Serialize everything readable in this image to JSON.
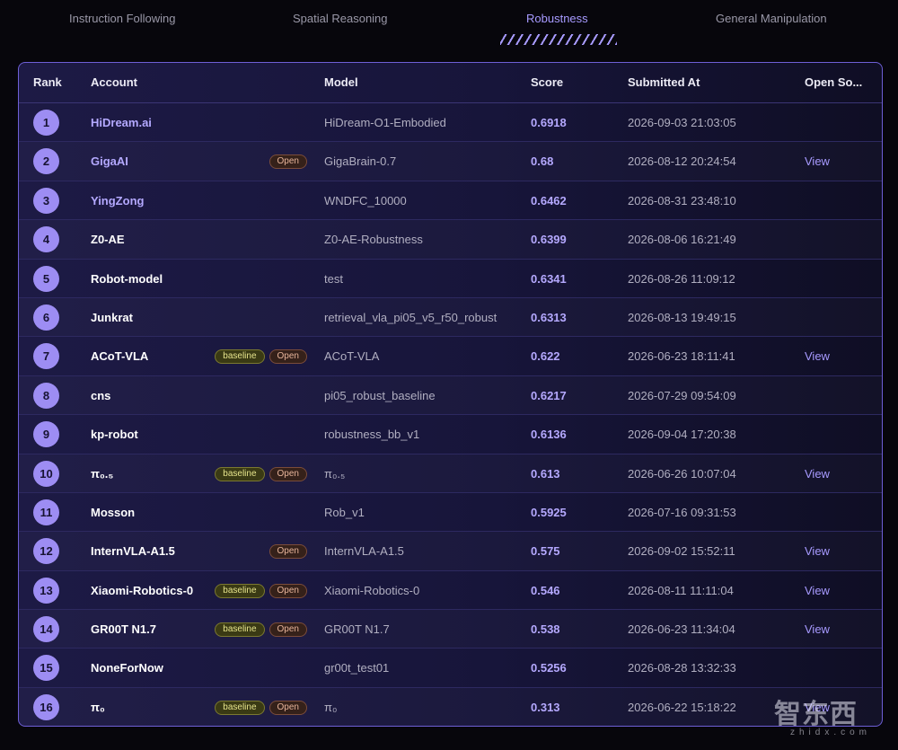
{
  "tabs": [
    {
      "label": "Instruction Following"
    },
    {
      "label": "Spatial Reasoning"
    },
    {
      "label": "Robustness"
    },
    {
      "label": "General Manipulation"
    }
  ],
  "active_tab": "Robustness",
  "table": {
    "headers": {
      "rank": "Rank",
      "account": "Account",
      "model": "Model",
      "score": "Score",
      "submitted": "Submitted At",
      "open_source": "Open So..."
    },
    "rows": [
      {
        "rank": "1",
        "account": "HiDream.ai",
        "highlight": true,
        "badges": [],
        "model": "HiDream-O1-Embodied",
        "score": "0.6918",
        "submitted": "2026-09-03 21:03:05",
        "link": ""
      },
      {
        "rank": "2",
        "account": "GigaAI",
        "highlight": true,
        "badges": [
          "Open"
        ],
        "model": "GigaBrain-0.7",
        "score": "0.68",
        "submitted": "2026-08-12 20:24:54",
        "link": "View"
      },
      {
        "rank": "3",
        "account": "YingZong",
        "highlight": true,
        "badges": [],
        "model": "WNDFC_10000",
        "score": "0.6462",
        "submitted": "2026-08-31 23:48:10",
        "link": ""
      },
      {
        "rank": "4",
        "account": "Z0-AE",
        "highlight": false,
        "badges": [],
        "model": "Z0-AE-Robustness",
        "score": "0.6399",
        "submitted": "2026-08-06 16:21:49",
        "link": ""
      },
      {
        "rank": "5",
        "account": "Robot-model",
        "highlight": false,
        "badges": [],
        "model": "test",
        "score": "0.6341",
        "submitted": "2026-08-26 11:09:12",
        "link": ""
      },
      {
        "rank": "6",
        "account": "Junkrat",
        "highlight": false,
        "badges": [],
        "model": "retrieval_vla_pi05_v5_r50_robust",
        "score": "0.6313",
        "submitted": "2026-08-13 19:49:15",
        "link": ""
      },
      {
        "rank": "7",
        "account": "ACoT-VLA",
        "highlight": false,
        "badges": [
          "baseline",
          "Open"
        ],
        "model": "ACoT-VLA",
        "score": "0.622",
        "submitted": "2026-06-23 18:11:41",
        "link": "View"
      },
      {
        "rank": "8",
        "account": "cns",
        "highlight": false,
        "badges": [],
        "model": "pi05_robust_baseline",
        "score": "0.6217",
        "submitted": "2026-07-29 09:54:09",
        "link": ""
      },
      {
        "rank": "9",
        "account": "kp-robot",
        "highlight": false,
        "badges": [],
        "model": "robustness_bb_v1",
        "score": "0.6136",
        "submitted": "2026-09-04 17:20:38",
        "link": ""
      },
      {
        "rank": "10",
        "account": "π₀.₅",
        "highlight": false,
        "badges": [
          "baseline",
          "Open"
        ],
        "model": "π₀.₅",
        "score": "0.613",
        "submitted": "2026-06-26 10:07:04",
        "link": "View"
      },
      {
        "rank": "11",
        "account": "Mosson",
        "highlight": false,
        "badges": [],
        "model": "Rob_v1",
        "score": "0.5925",
        "submitted": "2026-07-16 09:31:53",
        "link": ""
      },
      {
        "rank": "12",
        "account": "InternVLA-A1.5",
        "highlight": false,
        "badges": [
          "Open"
        ],
        "model": "InternVLA-A1.5",
        "score": "0.575",
        "submitted": "2026-09-02 15:52:11",
        "link": "View"
      },
      {
        "rank": "13",
        "account": "Xiaomi-Robotics-0",
        "highlight": false,
        "badges": [
          "baseline",
          "Open"
        ],
        "model": "Xiaomi-Robotics-0",
        "score": "0.546",
        "submitted": "2026-08-11 11:11:04",
        "link": "View"
      },
      {
        "rank": "14",
        "account": "GR00T N1.7",
        "highlight": false,
        "badges": [
          "baseline",
          "Open"
        ],
        "model": "GR00T N1.7",
        "score": "0.538",
        "submitted": "2026-06-23 11:34:04",
        "link": "View"
      },
      {
        "rank": "15",
        "account": "NoneForNow",
        "highlight": false,
        "badges": [],
        "model": "gr00t_test01",
        "score": "0.5256",
        "submitted": "2026-08-28 13:32:33",
        "link": ""
      },
      {
        "rank": "16",
        "account": "π₀",
        "highlight": false,
        "badges": [
          "baseline",
          "Open"
        ],
        "model": "π₀",
        "score": "0.313",
        "submitted": "2026-06-22 15:18:22",
        "link": "View"
      }
    ]
  },
  "watermark": {
    "text": "智东西",
    "sub": "zhidx.com"
  },
  "colors": {
    "accent": "#a79aff",
    "rank_badge": "#9d8df3",
    "background": "#07060c"
  }
}
